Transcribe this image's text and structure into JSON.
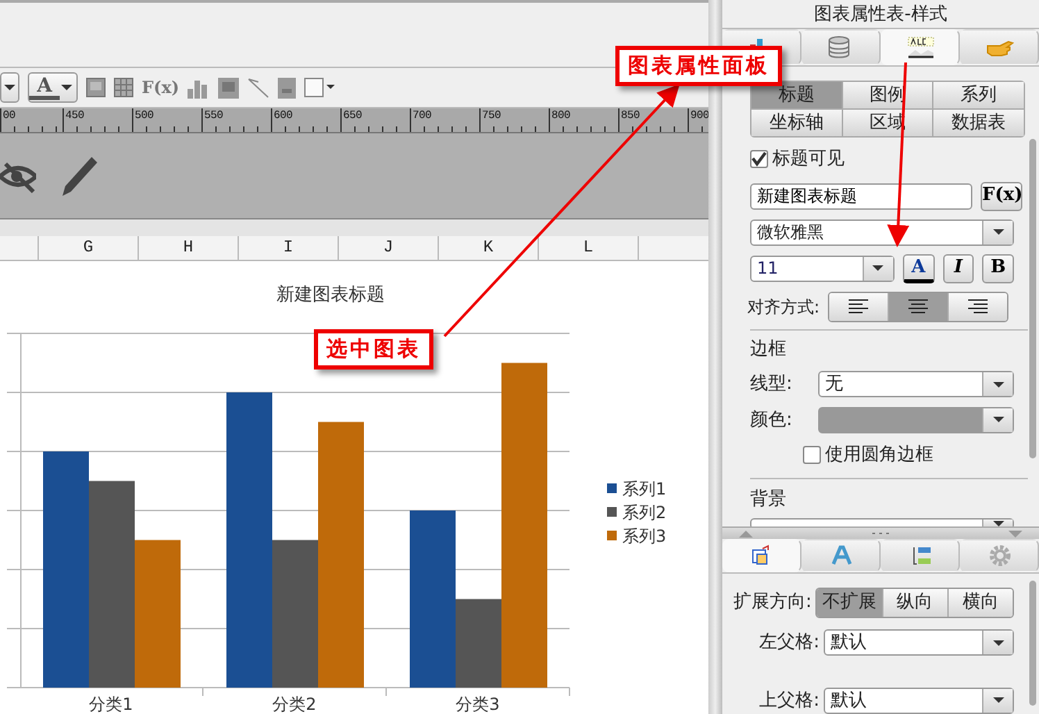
{
  "toolbar": {
    "font_color_button": "A",
    "formula_button": "F(x)"
  },
  "ruler": {
    "ticks": [
      "00",
      "450",
      "500",
      "550",
      "600",
      "650",
      "700",
      "750",
      "800",
      "850",
      "900"
    ]
  },
  "columns": [
    "G",
    "H",
    "I",
    "J",
    "K",
    "L"
  ],
  "chart": {
    "title": "新建图表标题",
    "categories": [
      "分类1",
      "分类2",
      "分类3"
    ],
    "legend": [
      {
        "name": "系列1",
        "color": "#1b4f93"
      },
      {
        "name": "系列2",
        "color": "#555555"
      },
      {
        "name": "系列3",
        "color": "#bf6a0a"
      }
    ]
  },
  "panel": {
    "title": "图表属性表-样式",
    "icon_tabs": [
      {
        "kind": "chart",
        "selected": false
      },
      {
        "kind": "database",
        "selected": false
      },
      {
        "kind": "style",
        "selected": true
      },
      {
        "kind": "hand",
        "selected": false
      }
    ],
    "sub_tabs": [
      {
        "label": "标题",
        "selected": true
      },
      {
        "label": "图例",
        "selected": false
      },
      {
        "label": "系列",
        "selected": false
      },
      {
        "label": "坐标轴",
        "selected": false
      },
      {
        "label": "区域",
        "selected": false
      },
      {
        "label": "数据表",
        "selected": false
      }
    ],
    "title_visible": {
      "label": "标题可见",
      "checked": true
    },
    "title_field": {
      "value": "新建图表标题",
      "formula_button": "F(x)"
    },
    "font": {
      "value": "微软雅黑"
    },
    "size": {
      "value": "11"
    },
    "style_buttons": [
      {
        "kind": "color",
        "label": "A"
      },
      {
        "kind": "italic",
        "label": "I"
      },
      {
        "kind": "bold",
        "label": "B"
      }
    ],
    "align": {
      "label": "对齐方式:",
      "options": [
        {
          "kind": "left",
          "selected": false
        },
        {
          "kind": "center",
          "selected": true
        },
        {
          "kind": "right",
          "selected": false
        }
      ]
    },
    "border": {
      "heading": "边框",
      "line_label": "线型:",
      "line_value": "无",
      "color_label": "颜色:",
      "rounded": {
        "label": "使用圆角边框",
        "checked": false
      }
    },
    "background": {
      "heading": "背景"
    },
    "bottom_tabs": [
      {
        "kind": "cell",
        "selected": true
      },
      {
        "kind": "text",
        "selected": false
      },
      {
        "kind": "layout",
        "selected": false
      },
      {
        "kind": "settings",
        "selected": false
      }
    ],
    "expand": {
      "label": "扩展方向:",
      "options": [
        {
          "label": "不扩展",
          "selected": true
        },
        {
          "label": "纵向",
          "selected": false
        },
        {
          "label": "横向",
          "selected": false
        }
      ]
    },
    "left_parent": {
      "label": "左父格:",
      "value": "默认"
    },
    "top_parent": {
      "label": "上父格:",
      "value": "默认"
    }
  },
  "annotations": [
    {
      "text": "图表属性面板"
    },
    {
      "text": "选中图表"
    }
  ]
}
